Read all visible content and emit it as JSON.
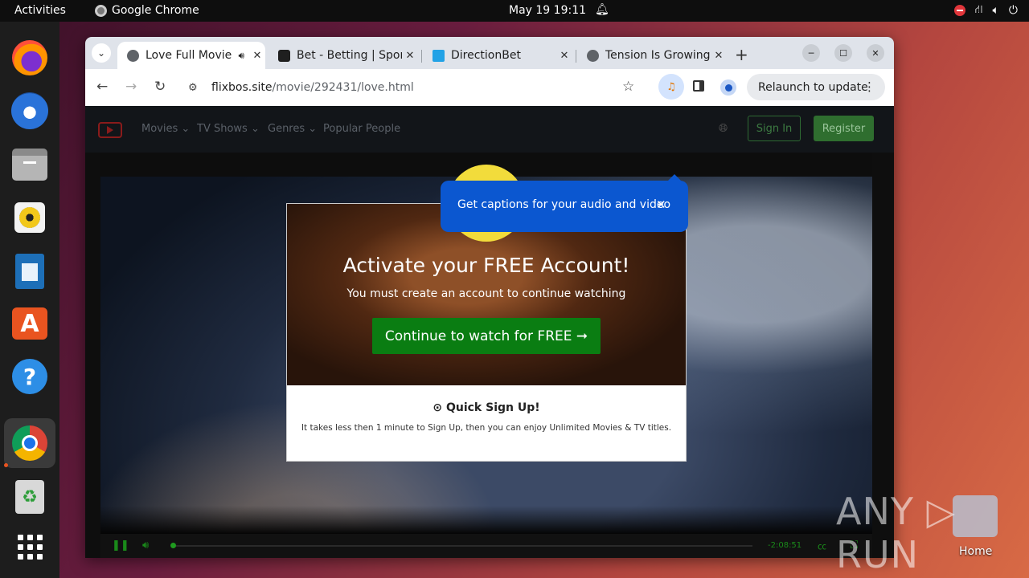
{
  "topbar": {
    "activities": "Activities",
    "app_name": "Google Chrome",
    "clock": "May 19  19:11"
  },
  "dock": {
    "items": [
      "firefox-icon",
      "thunderbird-icon",
      "files-icon",
      "rhythmbox-icon",
      "writer-icon",
      "app-center-icon",
      "help-icon",
      "chrome-icon",
      "trash-icon",
      "show-apps-icon"
    ]
  },
  "desktop": {
    "home_label": "Home"
  },
  "browser": {
    "tabs": [
      {
        "title": "Love Full Movie",
        "active": true
      },
      {
        "title": "Bet - Betting | Sports",
        "active": false
      },
      {
        "title": "DirectionBet",
        "active": false
      },
      {
        "title": "Tension Is Growing",
        "active": false
      }
    ],
    "url_host": "flixbos.site",
    "url_path": "/movie/292431/love.html",
    "relaunch_label": "Relaunch to update",
    "captions_bubble": "Get captions for your audio and video"
  },
  "site": {
    "menu": [
      "Movies ⌄",
      "TV Shows ⌄",
      "Genres ⌄",
      "Popular People"
    ],
    "signin": "Sign In",
    "register": "Register"
  },
  "modal": {
    "alert_glyph": "!",
    "title": "Activate your FREE Account!",
    "subtitle": "You must create an account to continue watching",
    "cta": "Continue to watch for FREE ➞",
    "quick_title": "⊙ Quick Sign Up!",
    "quick_text": "It takes less then 1 minute to Sign Up, then you can enjoy Unlimited Movies & TV titles."
  },
  "player": {
    "timecode": "-2:08:51",
    "progress_fraction": 0.0
  },
  "watermark": "ANY ▷ RUN"
}
